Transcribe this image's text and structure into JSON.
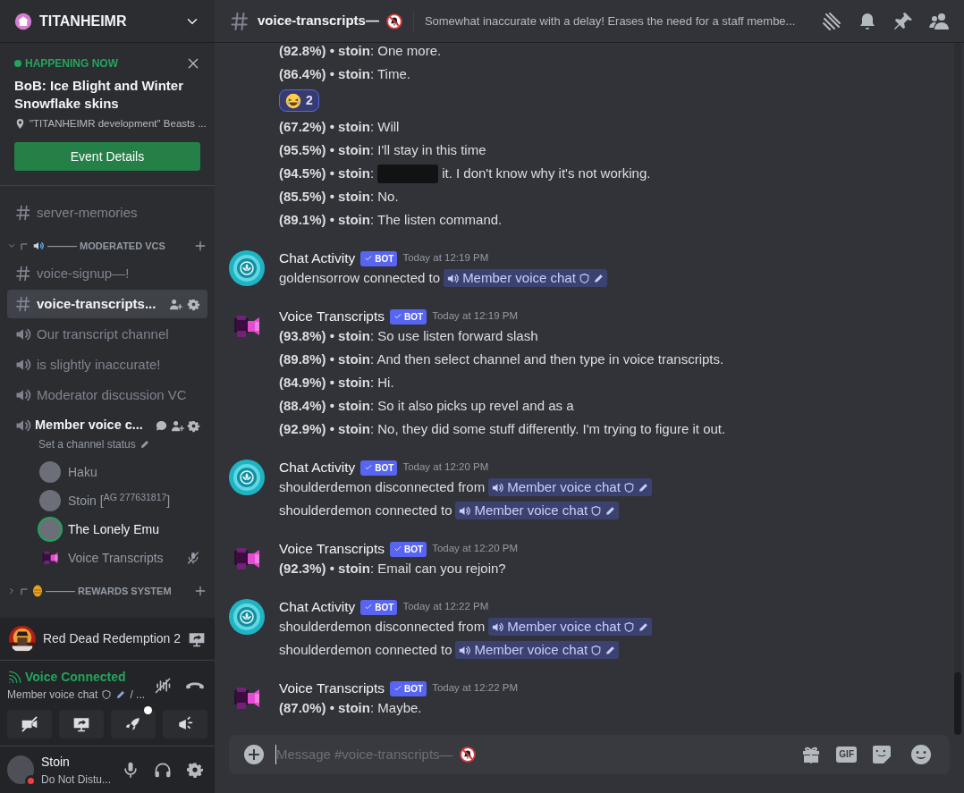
{
  "server": {
    "name": "TITANHEIMR"
  },
  "event": {
    "status": "HAPPENING NOW",
    "title": "BoB: Ice Blight and Winter Snowflake skins",
    "location": "\"TITANHEIMR development\" Beasts ...",
    "button": "Event Details"
  },
  "channels": [
    {
      "kind": "text",
      "name": "server-memories",
      "selected": false
    },
    {
      "kind": "category",
      "name": "——— MODERATED VCS",
      "expanded": true
    },
    {
      "kind": "text",
      "name": "voice-signup—!",
      "selected": false
    },
    {
      "kind": "text",
      "name": "voice-transcripts...",
      "selected": true
    },
    {
      "kind": "voice",
      "name": "Our transcript channel",
      "selected": false,
      "connected": false
    },
    {
      "kind": "voice",
      "name": "is slightly inaccurate!",
      "selected": false,
      "connected": false
    },
    {
      "kind": "voice",
      "name": "Moderator discussion VC",
      "selected": false,
      "connected": false
    },
    {
      "kind": "voice",
      "name": "Member voice c...",
      "selected": false,
      "connected": true,
      "status": "Set a channel status",
      "members": [
        {
          "name": "Haku",
          "bot": false,
          "speaking": false,
          "muted": false
        },
        {
          "name": "Stoin [$^{AG 277631817}$]",
          "bot": false,
          "speaking": false,
          "muted": false
        },
        {
          "name": "The Lonely Emu",
          "bot": false,
          "speaking": true,
          "muted": false
        },
        {
          "name": "Voice Transcripts",
          "bot": true,
          "speaking": false,
          "muted": true
        }
      ]
    },
    {
      "kind": "category",
      "name": "——— REWARDS SYSTEM",
      "expanded": false
    }
  ],
  "activity": {
    "game": "Red Dead Redemption 2"
  },
  "voice": {
    "status": "Voice Connected",
    "channel": "Member voice chat",
    "suffix": "/ ...",
    "buttons": [
      {
        "kind": "camera",
        "badge": false
      },
      {
        "kind": "screen",
        "badge": false
      },
      {
        "kind": "activity",
        "badge": true
      },
      {
        "kind": "soundboard",
        "badge": false
      }
    ]
  },
  "user": {
    "name": "Stoin",
    "status": "Do Not Distu...",
    "do_not_disturb": true
  },
  "header": {
    "channel": "voice-transcripts—",
    "topic": "Somewhat inaccurate with a delay! Erases the need for a staff membe..."
  },
  "messages": [
    {
      "continued": true,
      "lines": [
        {
          "kind": "text",
          "text": "**(92.8%) • stoin**: One more."
        },
        {
          "kind": "text",
          "text": "**(86.4%) • stoin**: Time."
        },
        {
          "kind": "reaction",
          "count": "2"
        },
        {
          "kind": "text",
          "text": "**(67.2%) • stoin**: Will"
        },
        {
          "kind": "text",
          "text": "**(95.5%) • stoin**: I'll stay in this time"
        },
        {
          "kind": "redacted",
          "before": "**(94.5%) • stoin**:",
          "after": "it. I don't know why it's not working."
        },
        {
          "kind": "text",
          "text": "**(85.5%) • stoin**: No."
        },
        {
          "kind": "text",
          "text": "**(89.1%) • stoin**: The listen command."
        }
      ]
    },
    {
      "continued": false,
      "author": "Chat Activity",
      "kind": "activity",
      "badge": "BOT",
      "time": "Today at 12:19 PM",
      "lines": [
        {
          "kind": "mention",
          "text": "goldensorrow connected to",
          "channel": "Member voice chat"
        }
      ]
    },
    {
      "continued": false,
      "author": "Voice Transcripts",
      "kind": "transcript",
      "badge": "BOT",
      "time": "Today at 12:19 PM",
      "lines": [
        {
          "kind": "text",
          "text": "**(93.8%) • stoin**: So use listen forward slash"
        },
        {
          "kind": "text",
          "text": "**(89.8%) • stoin**: And then select channel and then type in voice transcripts."
        },
        {
          "kind": "text",
          "text": "**(84.9%) • stoin**: Hi."
        },
        {
          "kind": "text",
          "text": "**(88.4%) • stoin**: So it also picks up revel and as a"
        },
        {
          "kind": "text",
          "text": "**(92.9%) • stoin**: No, they did some stuff differently. I'm trying to figure it out."
        }
      ]
    },
    {
      "continued": false,
      "author": "Chat Activity",
      "kind": "activity",
      "badge": "BOT",
      "time": "Today at 12:20 PM",
      "lines": [
        {
          "kind": "mention",
          "text": "shoulderdemon disconnected from",
          "channel": "Member voice chat"
        },
        {
          "kind": "mention",
          "text": "shoulderdemon connected to",
          "channel": "Member voice chat"
        }
      ]
    },
    {
      "continued": false,
      "author": "Voice Transcripts",
      "kind": "transcript",
      "badge": "BOT",
      "time": "Today at 12:20 PM",
      "lines": [
        {
          "kind": "text",
          "text": "**(92.3%) • stoin**: Email can you rejoin?"
        }
      ]
    },
    {
      "continued": false,
      "author": "Chat Activity",
      "kind": "activity",
      "badge": "BOT",
      "time": "Today at 12:22 PM",
      "lines": [
        {
          "kind": "mention",
          "text": "shoulderdemon disconnected from",
          "channel": "Member voice chat"
        },
        {
          "kind": "mention",
          "text": "shoulderdemon connected to",
          "channel": "Member voice chat"
        }
      ]
    },
    {
      "continued": false,
      "author": "Voice Transcripts",
      "kind": "transcript",
      "badge": "BOT",
      "time": "Today at 12:22 PM",
      "lines": [
        {
          "kind": "text",
          "text": "**(87.0%) • stoin**: Maybe."
        }
      ]
    }
  ],
  "composer": {
    "placeholder": "Message #voice-transcripts—",
    "gif": "GIF"
  }
}
